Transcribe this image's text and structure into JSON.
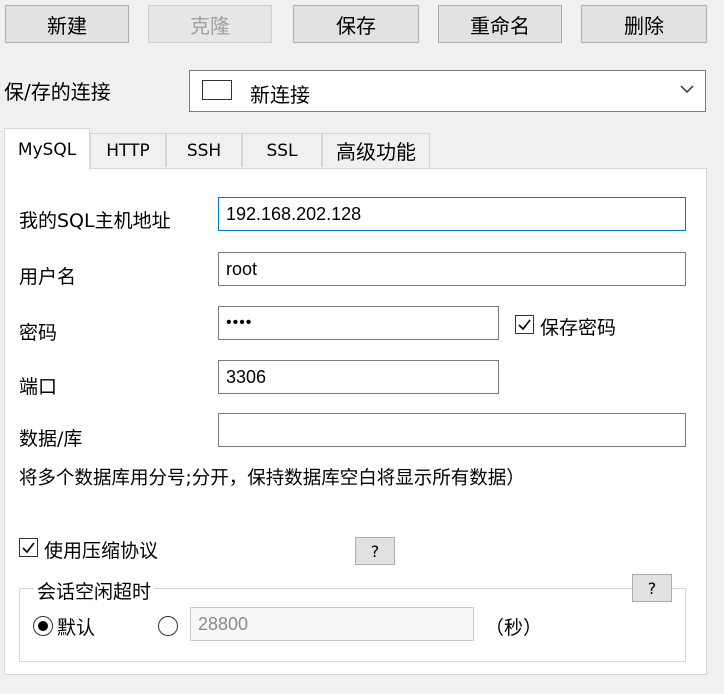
{
  "toolbar": {
    "new_label": "新建",
    "clone_label": "克隆",
    "save_label": "保存",
    "rename_label": "重命名",
    "delete_label": "删除"
  },
  "connection": {
    "label": "保/存的连接",
    "selected": "新连接"
  },
  "tabs": [
    {
      "label": "MySQL",
      "active": true
    },
    {
      "label": "HTTP"
    },
    {
      "label": "SSH"
    },
    {
      "label": "SSL"
    },
    {
      "label": "高级功能"
    }
  ],
  "mysql": {
    "host_label": "我的SQL主机地址",
    "host_value": "192.168.202.128",
    "user_label": "用户名",
    "user_value": "root",
    "password_label": "密码",
    "password_mask": "••••",
    "save_password_label": "保存密码",
    "save_password_checked": true,
    "port_label": "端口",
    "port_value": "3306",
    "database_label": "数据/库",
    "database_value": "",
    "hint": "将多个数据库用分号;分开，保持数据库空白将显示所有数据）",
    "compression_label": "使用压缩协议",
    "compression_checked": true,
    "help_label": "?"
  },
  "session": {
    "group_label": "会话空闲超时",
    "help_label": "?",
    "default_label": "默认",
    "default_selected": true,
    "custom_value": "28800",
    "unit_label": "（秒）"
  },
  "icons": {
    "checkmark": "check-icon",
    "dropdown": "chevron-down-icon"
  }
}
